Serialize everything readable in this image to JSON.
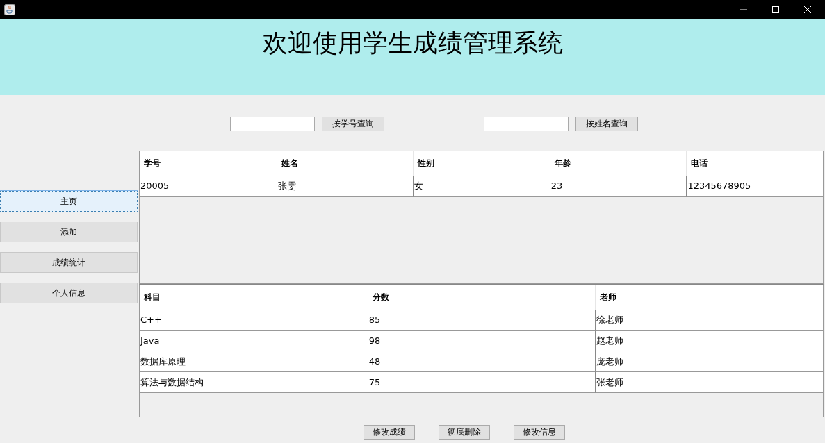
{
  "header": {
    "title": "欢迎使用学生成绩管理系统"
  },
  "search": [
    {
      "button": "按学号查询"
    },
    {
      "button": "按姓名查询"
    }
  ],
  "sidebar": {
    "items": [
      {
        "label": "主页",
        "selected": true
      },
      {
        "label": "添加",
        "selected": false
      },
      {
        "label": "成绩统计",
        "selected": false
      },
      {
        "label": "个人信息",
        "selected": false
      }
    ]
  },
  "student_table": {
    "columns": [
      "学号",
      "姓名",
      "性别",
      "年龄",
      "电话"
    ],
    "rows": [
      [
        "20005",
        "张雯",
        "女",
        "23",
        "12345678905"
      ]
    ]
  },
  "score_table": {
    "columns": [
      "科目",
      "分数",
      "老师"
    ],
    "rows": [
      [
        "C++",
        "85",
        "徐老师"
      ],
      [
        "Java",
        "98",
        "赵老师"
      ],
      [
        "数据库原理",
        "48",
        "庞老师"
      ],
      [
        "算法与数据结构",
        "75",
        "张老师"
      ]
    ]
  },
  "actions": [
    "修改成绩",
    "彻底删除",
    "修改信息"
  ]
}
